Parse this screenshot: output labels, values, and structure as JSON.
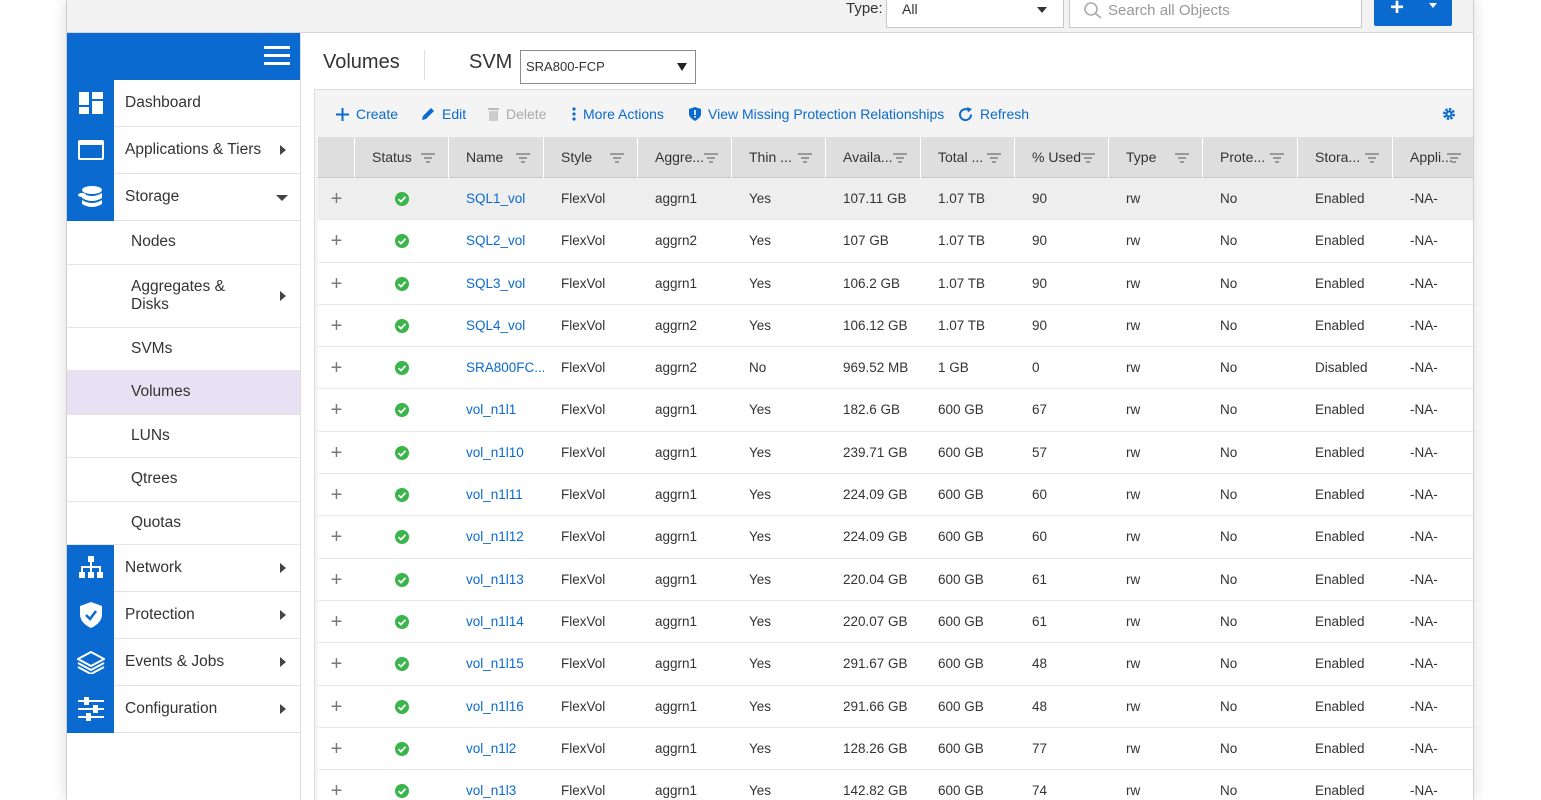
{
  "topbar": {
    "type_label": "Type:",
    "type_value": "All",
    "search_placeholder": "Search all Objects"
  },
  "sidebar": {
    "items": [
      {
        "label": "Dashboard",
        "icon": "dashboard-icon"
      },
      {
        "label": "Applications & Tiers",
        "icon": "applications-icon"
      },
      {
        "label": "Storage",
        "icon": "storage-icon"
      }
    ],
    "storage_sub": [
      {
        "label": "Nodes"
      },
      {
        "label": "Aggregates & Disks"
      },
      {
        "label": "SVMs"
      },
      {
        "label": "Volumes"
      },
      {
        "label": "LUNs"
      },
      {
        "label": "Qtrees"
      },
      {
        "label": "Quotas"
      }
    ],
    "items_after": [
      {
        "label": "Network",
        "icon": "network-icon"
      },
      {
        "label": "Protection",
        "icon": "protection-icon"
      },
      {
        "label": "Events & Jobs",
        "icon": "events-icon"
      },
      {
        "label": "Configuration",
        "icon": "configuration-icon"
      }
    ]
  },
  "main": {
    "title": "Volumes",
    "svm_label": "SVM",
    "svm_value": "SRA800-FCP"
  },
  "toolbar": {
    "create": "Create",
    "edit": "Edit",
    "delete": "Delete",
    "more_actions": "More Actions",
    "view_missing": "View Missing Protection Relationships",
    "refresh": "Refresh"
  },
  "colors": {
    "accent": "#0a6acf",
    "status_ok": "#3ab54a",
    "active_nav": "#e6e1f3"
  },
  "table": {
    "headers": [
      "Status",
      "Name",
      "Style",
      "Aggre...",
      "Thin ...",
      "Availa...",
      "Total ...",
      "% Used",
      "Type",
      "Prote...",
      "Stora...",
      "Appli..."
    ],
    "rows": [
      {
        "name": "SQL1_vol",
        "style": "FlexVol",
        "aggr": "aggrn1",
        "thin": "Yes",
        "avail": "107.11 GB",
        "total": "1.07 TB",
        "used": "90",
        "type": "rw",
        "prot": "No",
        "storage": "Enabled",
        "app": "-NA-"
      },
      {
        "name": "SQL2_vol",
        "style": "FlexVol",
        "aggr": "aggrn2",
        "thin": "Yes",
        "avail": "107 GB",
        "total": "1.07 TB",
        "used": "90",
        "type": "rw",
        "prot": "No",
        "storage": "Enabled",
        "app": "-NA-"
      },
      {
        "name": "SQL3_vol",
        "style": "FlexVol",
        "aggr": "aggrn1",
        "thin": "Yes",
        "avail": "106.2 GB",
        "total": "1.07 TB",
        "used": "90",
        "type": "rw",
        "prot": "No",
        "storage": "Enabled",
        "app": "-NA-"
      },
      {
        "name": "SQL4_vol",
        "style": "FlexVol",
        "aggr": "aggrn2",
        "thin": "Yes",
        "avail": "106.12 GB",
        "total": "1.07 TB",
        "used": "90",
        "type": "rw",
        "prot": "No",
        "storage": "Enabled",
        "app": "-NA-"
      },
      {
        "name": "SRA800FC...",
        "style": "FlexVol",
        "aggr": "aggrn2",
        "thin": "No",
        "avail": "969.52 MB",
        "total": "1 GB",
        "used": "0",
        "type": "rw",
        "prot": "No",
        "storage": "Disabled",
        "app": "-NA-"
      },
      {
        "name": "vol_n1l1",
        "style": "FlexVol",
        "aggr": "aggrn1",
        "thin": "Yes",
        "avail": "182.6 GB",
        "total": "600 GB",
        "used": "67",
        "type": "rw",
        "prot": "No",
        "storage": "Enabled",
        "app": "-NA-"
      },
      {
        "name": "vol_n1l10",
        "style": "FlexVol",
        "aggr": "aggrn1",
        "thin": "Yes",
        "avail": "239.71 GB",
        "total": "600 GB",
        "used": "57",
        "type": "rw",
        "prot": "No",
        "storage": "Enabled",
        "app": "-NA-"
      },
      {
        "name": "vol_n1l11",
        "style": "FlexVol",
        "aggr": "aggrn1",
        "thin": "Yes",
        "avail": "224.09 GB",
        "total": "600 GB",
        "used": "60",
        "type": "rw",
        "prot": "No",
        "storage": "Enabled",
        "app": "-NA-"
      },
      {
        "name": "vol_n1l12",
        "style": "FlexVol",
        "aggr": "aggrn1",
        "thin": "Yes",
        "avail": "224.09 GB",
        "total": "600 GB",
        "used": "60",
        "type": "rw",
        "prot": "No",
        "storage": "Enabled",
        "app": "-NA-"
      },
      {
        "name": "vol_n1l13",
        "style": "FlexVol",
        "aggr": "aggrn1",
        "thin": "Yes",
        "avail": "220.04 GB",
        "total": "600 GB",
        "used": "61",
        "type": "rw",
        "prot": "No",
        "storage": "Enabled",
        "app": "-NA-"
      },
      {
        "name": "vol_n1l14",
        "style": "FlexVol",
        "aggr": "aggrn1",
        "thin": "Yes",
        "avail": "220.07 GB",
        "total": "600 GB",
        "used": "61",
        "type": "rw",
        "prot": "No",
        "storage": "Enabled",
        "app": "-NA-"
      },
      {
        "name": "vol_n1l15",
        "style": "FlexVol",
        "aggr": "aggrn1",
        "thin": "Yes",
        "avail": "291.67 GB",
        "total": "600 GB",
        "used": "48",
        "type": "rw",
        "prot": "No",
        "storage": "Enabled",
        "app": "-NA-"
      },
      {
        "name": "vol_n1l16",
        "style": "FlexVol",
        "aggr": "aggrn1",
        "thin": "Yes",
        "avail": "291.66 GB",
        "total": "600 GB",
        "used": "48",
        "type": "rw",
        "prot": "No",
        "storage": "Enabled",
        "app": "-NA-"
      },
      {
        "name": "vol_n1l2",
        "style": "FlexVol",
        "aggr": "aggrn1",
        "thin": "Yes",
        "avail": "128.26 GB",
        "total": "600 GB",
        "used": "77",
        "type": "rw",
        "prot": "No",
        "storage": "Enabled",
        "app": "-NA-"
      },
      {
        "name": "vol_n1l3",
        "style": "FlexVol",
        "aggr": "aggrn1",
        "thin": "Yes",
        "avail": "142.82 GB",
        "total": "600 GB",
        "used": "74",
        "type": "rw",
        "prot": "No",
        "storage": "Enabled",
        "app": "-NA-"
      }
    ]
  }
}
